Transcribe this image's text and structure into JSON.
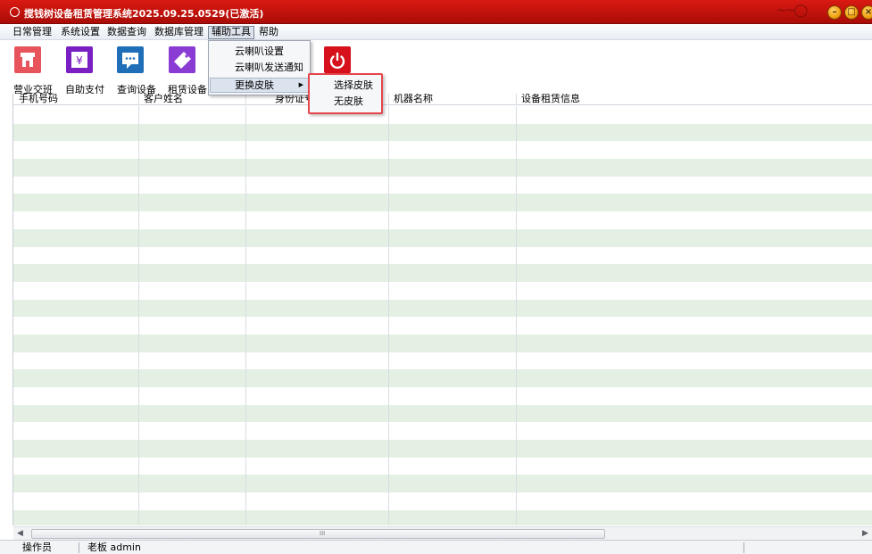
{
  "window": {
    "title": "搅钱树设备租赁管理系统2025.09.25.0529(已激活)",
    "minimize_label": "–",
    "maximize_label": "□",
    "close_label": "×"
  },
  "menubar": {
    "items": [
      {
        "label": "日常管理"
      },
      {
        "label": "系统设置"
      },
      {
        "label": "数据查询"
      },
      {
        "label": "数据库管理"
      },
      {
        "label": "辅助工具"
      },
      {
        "label": "帮助"
      }
    ]
  },
  "toolbar": {
    "buttons": [
      {
        "label": "营业交班",
        "icon": "shop-icon",
        "color": "#e8545c"
      },
      {
        "label": "自助支付",
        "icon": "yen-icon",
        "color": "#7a1fc2"
      },
      {
        "label": "查询设备",
        "icon": "chat-icon",
        "color": "#1f6fb8"
      },
      {
        "label": "租赁设备",
        "icon": "tag-icon",
        "color": "#8a3bd3"
      },
      {
        "label": "",
        "icon": "power-icon",
        "color": "#d6111b"
      }
    ]
  },
  "dropdown": {
    "items": [
      {
        "label": "云喇叭设置"
      },
      {
        "label": "云喇叭发送通知"
      },
      {
        "label": "更换皮肤",
        "has_submenu": true
      }
    ]
  },
  "submenu": {
    "items": [
      {
        "label": "选择皮肤"
      },
      {
        "label": "无皮肤"
      }
    ],
    "highlight_color": "#e5454b"
  },
  "grid": {
    "columns": [
      {
        "label": "手机号码"
      },
      {
        "label": "客户姓名"
      },
      {
        "label": "身份证号"
      },
      {
        "label": "机器名称"
      },
      {
        "label": "设备租赁信息"
      }
    ],
    "alt_row_color": "#e4f0e3"
  },
  "scrollbar": {
    "left_arrow": "◀",
    "right_arrow": "▶",
    "grip": "III"
  },
  "statusbar": {
    "operator_label": "操作员",
    "user_value": "老板 admin"
  }
}
